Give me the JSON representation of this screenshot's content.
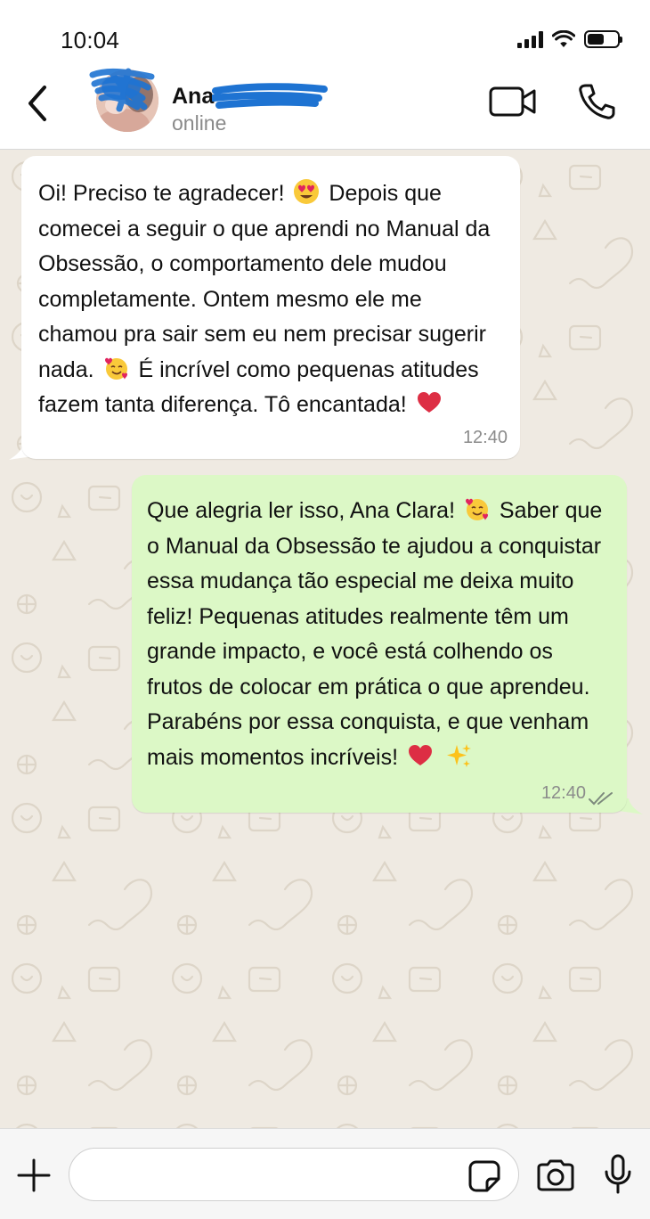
{
  "status_bar": {
    "time": "10:04",
    "battery_level": 0.55
  },
  "header": {
    "contact_name": "Ana",
    "contact_status": "online",
    "icons": [
      "chevron-left-icon",
      "video-camera-icon",
      "phone-icon"
    ]
  },
  "messages": [
    {
      "direction": "incoming",
      "segments": [
        "Oi! Preciso te agradecer!",
        "Depois que comecei a seguir o que aprendi no Manual da Obsessão, o comportamento dele mudou completamente. Ontem mesmo ele me chamou pra sair sem eu nem precisar sugerir nada.",
        "É incrível como pequenas atitudes fazem tanta diferença. Tô encantada!"
      ],
      "emojis": [
        "heart-eyes-emoji",
        "smiling-hearts-emoji",
        "red-heart-emoji"
      ],
      "time": "12:40"
    },
    {
      "direction": "outgoing",
      "segments": [
        "Que alegria ler isso, Ana Clara!",
        "Saber que o Manual da Obsessão te ajudou a conquistar essa mudança tão especial me deixa muito feliz! Pequenas atitudes realmente têm um grande impacto, e você está colhendo os frutos de colocar em prática o que aprendeu. Parabéns por essa conquista, e que venham mais momentos incríveis!"
      ],
      "emojis": [
        "smiling-hearts-emoji",
        "red-heart-emoji",
        "sparkles-emoji"
      ],
      "time": "12:40",
      "read_status": "read"
    }
  ],
  "input_bar": {
    "placeholder": "",
    "icons": [
      "plus-icon",
      "sticker-icon",
      "camera-icon",
      "microphone-icon"
    ]
  },
  "colors": {
    "chat_background": "#efeae2",
    "incoming_bubble": "#ffffff",
    "outgoing_bubble": "#dcf8c6",
    "scribble_blue": "#1e73d2",
    "secondary_text": "#8a8a8a"
  }
}
